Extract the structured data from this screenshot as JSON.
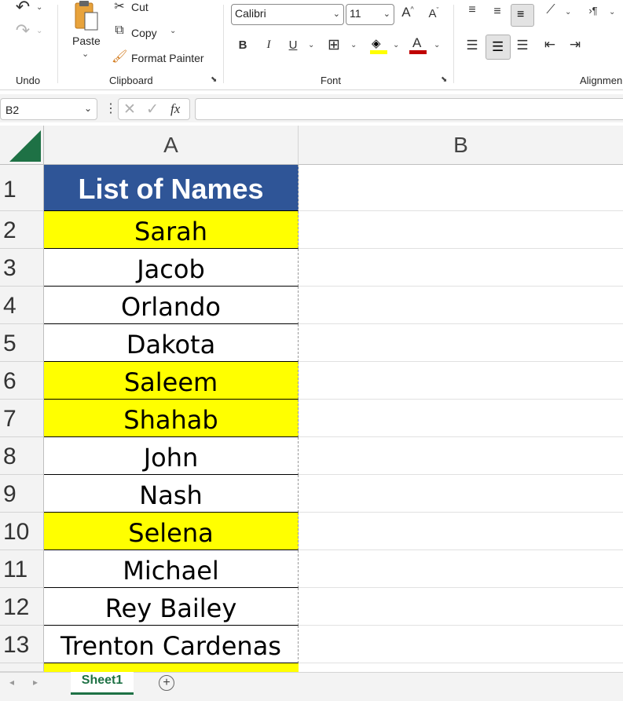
{
  "ribbon": {
    "undo_label": "Undo",
    "clipboard": {
      "paste_label": "Paste",
      "cut_label": "Cut",
      "copy_label": "Copy",
      "format_painter_label": "Format Painter",
      "group_label": "Clipboard"
    },
    "font": {
      "font_name": "Calibri",
      "font_size": "11",
      "bold": "B",
      "italic": "I",
      "underline": "U",
      "group_label": "Font",
      "fill_color": "#ffff00",
      "font_color": "#c00000"
    },
    "alignment": {
      "group_label": "Alignmen"
    }
  },
  "formula_bar": {
    "name_box": "B2",
    "fx": "fx",
    "formula": ""
  },
  "columns": [
    "A",
    "B"
  ],
  "rows": [
    {
      "num": "1",
      "value": "List of Names",
      "style": "header"
    },
    {
      "num": "2",
      "value": "Sarah",
      "style": "yellow"
    },
    {
      "num": "3",
      "value": "Jacob",
      "style": "white"
    },
    {
      "num": "4",
      "value": "Orlando",
      "style": "white"
    },
    {
      "num": "5",
      "value": "Dakota",
      "style": "white"
    },
    {
      "num": "6",
      "value": "Saleem",
      "style": "yellow"
    },
    {
      "num": "7",
      "value": "Shahab",
      "style": "yellow"
    },
    {
      "num": "8",
      "value": "John",
      "style": "white"
    },
    {
      "num": "9",
      "value": "Nash",
      "style": "white"
    },
    {
      "num": "10",
      "value": "Selena",
      "style": "yellow"
    },
    {
      "num": "11",
      "value": "Michael",
      "style": "white"
    },
    {
      "num": "12",
      "value": "Rey Bailey",
      "style": "white"
    },
    {
      "num": "13",
      "value": "Trenton Cardenas",
      "style": "white"
    }
  ],
  "colors": {
    "header_fill": "#2f5597",
    "header_text": "#ffffff",
    "highlight_fill": "#ffff00",
    "accent_green": "#1e7145"
  },
  "sheets": [
    {
      "name": "Sheet1",
      "active": true
    }
  ]
}
